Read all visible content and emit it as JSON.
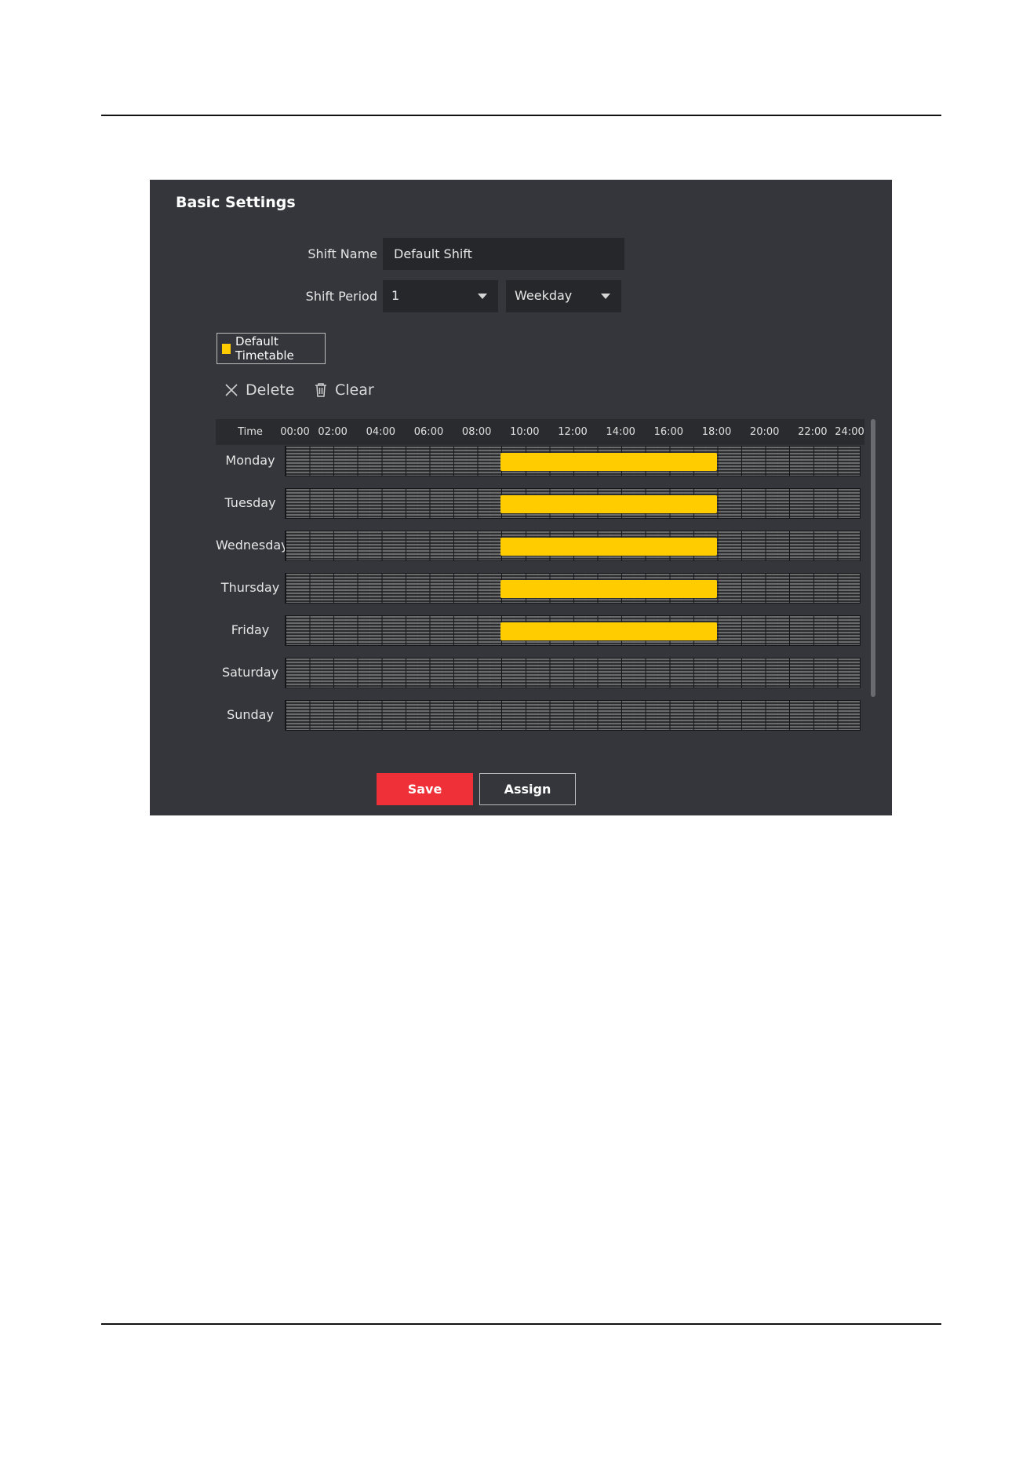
{
  "panel": {
    "title": "Basic Settings"
  },
  "form": {
    "shift_name_label": "Shift Name",
    "shift_name_value": "Default Shift",
    "shift_period_label": "Shift Period",
    "period_count": "1",
    "period_unit": "Weekday"
  },
  "timetable": {
    "label": "Default Timetable",
    "color": "#ffcc00"
  },
  "toolbar": {
    "delete_label": "Delete",
    "clear_label": "Clear"
  },
  "schedule": {
    "time_header": "Time",
    "ticks": [
      "00:00",
      "02:00",
      "04:00",
      "06:00",
      "08:00",
      "10:00",
      "12:00",
      "14:00",
      "16:00",
      "18:00",
      "20:00",
      "22:00",
      "24:00"
    ],
    "days": [
      {
        "name": "Monday",
        "start": 9,
        "end": 18
      },
      {
        "name": "Tuesday",
        "start": 9,
        "end": 18
      },
      {
        "name": "Wednesday",
        "start": 9,
        "end": 18
      },
      {
        "name": "Thursday",
        "start": 9,
        "end": 18
      },
      {
        "name": "Friday",
        "start": 9,
        "end": 18
      },
      {
        "name": "Saturday",
        "start": null,
        "end": null
      },
      {
        "name": "Sunday",
        "start": null,
        "end": null
      }
    ]
  },
  "actions": {
    "save_label": "Save",
    "assign_label": "Assign"
  },
  "colors": {
    "panel_bg": "#35363b",
    "accent_save": "#f03038",
    "shift_bar": "#ffcc00"
  }
}
